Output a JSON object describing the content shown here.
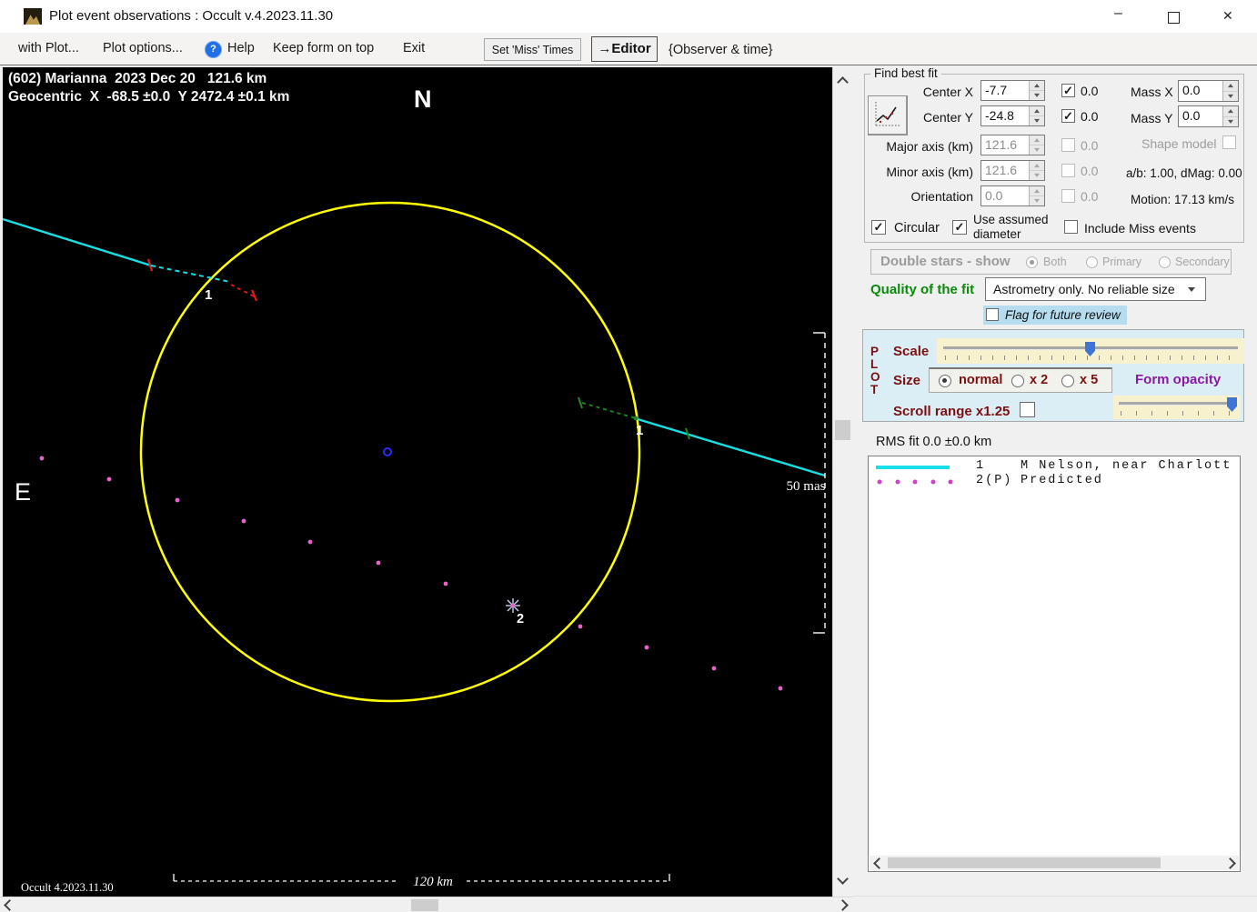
{
  "window": {
    "title": "Plot event observations : Occult v.4.2023.11.30"
  },
  "icons": {
    "minimize": "–",
    "close": "✕",
    "help_q": "?",
    "left": "‹",
    "right": "›",
    "up": "∧",
    "down": "∨"
  },
  "menu": {
    "with_plot": "with Plot...",
    "plot_options": "Plot options...",
    "help": "Help",
    "keep_on_top": "Keep form on top",
    "exit": "Exit",
    "set_miss_times": "Set 'Miss' Times",
    "editor": "→Editor",
    "observer_time": "{Observer & time}"
  },
  "plot": {
    "header_line1": "(602) Marianna  2023 Dec 20   121.6 km",
    "header_line2": "Geocentric  X  -68.5 ±0.0  Y 2472.4 ±0.1 km",
    "north": "N",
    "east": "E",
    "chord1_label": "1",
    "predicted_label": "2",
    "mas_scale": "50 mas",
    "km_scale": "120 km",
    "version": "Occult 4.2023.11.30",
    "colors": {
      "circle": "#ffff00",
      "chord": "#17dfe4",
      "predicted": "#e863cc",
      "d_uncertainty": "#e31b1b",
      "r_uncertainty": "#1d8c1d",
      "center": "#2b2bff"
    }
  },
  "fit": {
    "title": "Find best fit",
    "center_x_label": "Center X",
    "center_x": "-7.7",
    "center_x_err": "0.0",
    "center_y_label": "Center Y",
    "center_y": "-24.8",
    "center_y_err": "0.0",
    "mass_x_label": "Mass X",
    "mass_x": "0.0",
    "mass_y_label": "Mass Y",
    "mass_y": "0.0",
    "major_label": "Major axis (km)",
    "major": "121.6",
    "major_err": "0.0",
    "minor_label": "Minor axis (km)",
    "minor": "121.6",
    "minor_err": "0.0",
    "orientation_label": "Orientation",
    "orientation": "0.0",
    "orientation_err": "0.0",
    "shape_model": "Shape model",
    "ab_dmag": "a/b: 1.00, dMag: 0.00",
    "motion": "Motion: 17.13 km/s",
    "circular": "Circular",
    "use_assumed_1": "Use assumed",
    "use_assumed_2": "diameter",
    "include_miss": "Include Miss events"
  },
  "double_stars": {
    "title": "Double stars - show",
    "options": [
      "Both",
      "Primary",
      "Secondary"
    ]
  },
  "quality": {
    "label": "Quality of the fit",
    "value": "Astrometry only. No reliable size",
    "flag": "Flag for future review"
  },
  "plot_controls": {
    "group": "PLOT",
    "scale": "Scale",
    "size": "Size",
    "size_options": [
      "normal",
      "x 2",
      "x 5"
    ],
    "form_opacity": "Form opacity",
    "scroll_range": "Scroll range x1.25"
  },
  "rms": {
    "label": "RMS fit 0.0 ±0.0 km"
  },
  "observers": [
    {
      "id": "1",
      "name": "M Nelson, near Charlott"
    },
    {
      "id": "2(P)",
      "name": "Predicted"
    }
  ]
}
